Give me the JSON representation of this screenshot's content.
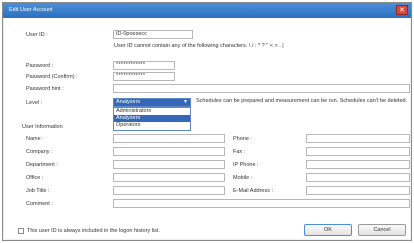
{
  "window": {
    "title": "Edit User Account",
    "close_glyph": "✕"
  },
  "user_id": {
    "label": "User ID :",
    "value": "ID-0poesecc",
    "hint": "User ID cannot contain any of the following characters. \\ / : * ? \" < > . |"
  },
  "password": {
    "label": "Password :",
    "value": "************"
  },
  "password_confirm": {
    "label": "Password (Confirm) :",
    "value": "************"
  },
  "password_hint": {
    "label": "Password hint :",
    "value": ""
  },
  "level": {
    "label": "Level :",
    "selected": "Analyzers",
    "options": [
      "Administrators",
      "Analyzers",
      "Operators"
    ],
    "description": "Schedules can be prepared and measurement can be run. Schedules can't be deleted."
  },
  "user_information": {
    "heading": "User Information",
    "left_fields": [
      {
        "label": "Name :",
        "value": ""
      },
      {
        "label": "Company :",
        "value": ""
      },
      {
        "label": "Department :",
        "value": ""
      },
      {
        "label": "Office :",
        "value": ""
      },
      {
        "label": "Job Title :",
        "value": ""
      },
      {
        "label": "Comment :",
        "value": ""
      }
    ],
    "right_fields": [
      {
        "label": "Phone :",
        "value": ""
      },
      {
        "label": "Fax :",
        "value": ""
      },
      {
        "label": "IP Phone :",
        "value": ""
      },
      {
        "label": "Mobile :",
        "value": ""
      },
      {
        "label": "E-Mail Address :",
        "value": ""
      }
    ]
  },
  "logon_history_checkbox": {
    "label": "This user ID is always included in the logon history list.",
    "checked": false
  },
  "buttons": {
    "ok": "OK",
    "cancel": "Cancel"
  },
  "colors": {
    "titlebar": "#2d6fc1",
    "selection": "#3467b7",
    "close": "#d9473b"
  }
}
